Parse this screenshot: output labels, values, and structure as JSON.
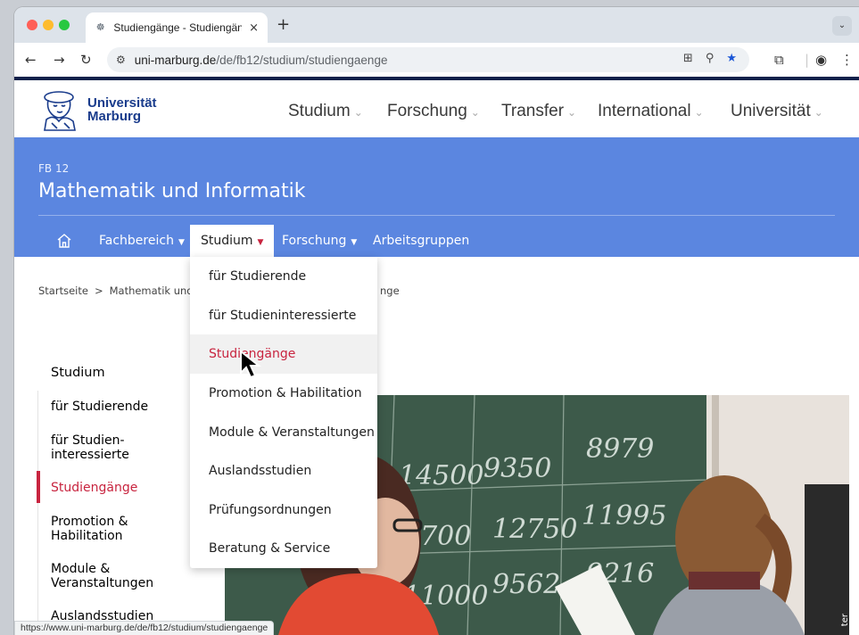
{
  "browser": {
    "tab_title": "Studiengänge - Studiengänge",
    "tab_close": "×",
    "new_tab": "+",
    "url_host": "uni-marburg.de",
    "url_path": "/de/fb12/studium/studiengaenge",
    "status_url": "https://www.uni-marburg.de/de/fb12/studium/studiengaenge",
    "icons": [
      "back-icon",
      "forward-icon",
      "reload-icon",
      "site-info-icon",
      "translate-icon",
      "zoom-icon",
      "bookmark-star-icon",
      "extensions-icon",
      "profile-icon",
      "menu-icon"
    ]
  },
  "header": {
    "uni_name_line1": "Universität",
    "uni_name_line2": "Marburg",
    "nav": [
      {
        "label": "Studium"
      },
      {
        "label": "Forschung"
      },
      {
        "label": "Transfer"
      },
      {
        "label": "International"
      },
      {
        "label": "Universität"
      }
    ]
  },
  "band": {
    "fb_label": "FB 12",
    "title": "Mathematik und Informatik",
    "subnav": [
      {
        "label": "Fachbereich"
      },
      {
        "label": "Studium"
      },
      {
        "label": "Forschung"
      },
      {
        "label": "Arbeitsgruppen"
      }
    ]
  },
  "breadcrumb": {
    "items": [
      "Startseite",
      "Mathematik und",
      "nge"
    ],
    "separator": ">"
  },
  "dropdown": {
    "items": [
      {
        "label": "für Studierende"
      },
      {
        "label": "für Studieninteressierte"
      },
      {
        "label": "Studiengänge"
      },
      {
        "label": "Promotion & Habilitation"
      },
      {
        "label": "Module & Veranstaltungen"
      },
      {
        "label": "Auslandsstudien"
      },
      {
        "label": "Prüfungsordnungen"
      },
      {
        "label": "Beratung & Service"
      }
    ],
    "hovered_index": 2
  },
  "sidebar": {
    "heading": "Studium",
    "items": [
      {
        "label": "für Studierende"
      },
      {
        "label": "für Studien-\ninteressierte"
      },
      {
        "label": "Studiengänge"
      },
      {
        "label": "Promotion &\nHabilitation"
      },
      {
        "label": "Module &\nVeranstaltungen"
      },
      {
        "label": "Auslandsstudien"
      }
    ],
    "active_index": 2
  },
  "photo": {
    "credit": "ter",
    "board_numbers": [
      "14500",
      "9350",
      "8979",
      "8700",
      "12750",
      "11995",
      "11000",
      "9562",
      "9216"
    ]
  },
  "colors": {
    "band_blue": "#5b86e0",
    "accent_red": "#c8243f",
    "header_navy": "#10214b",
    "logo_blue": "#1a3c8c"
  }
}
